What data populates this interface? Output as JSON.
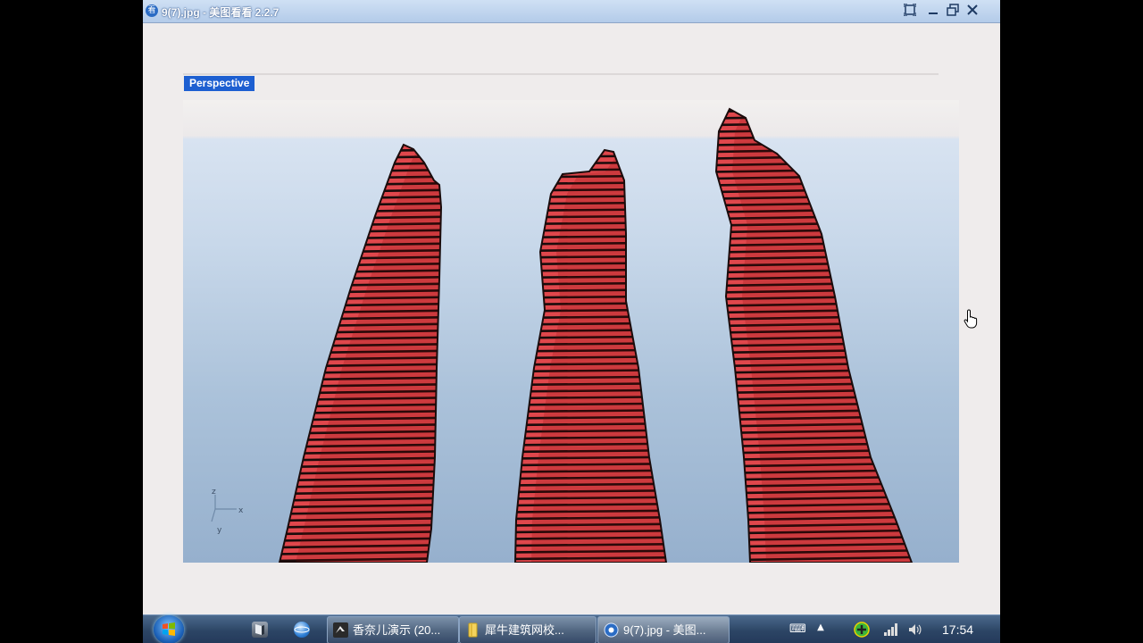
{
  "window": {
    "title": "9(7).jpg - 美图看看 2.2.7",
    "app_icon_glyph": "看",
    "controls": [
      "fullscreen",
      "minimize",
      "restore",
      "close"
    ]
  },
  "viewer": {
    "viewport_label": "Perspective",
    "axis_labels": {
      "z": "z",
      "x": "x",
      "y": "y"
    },
    "model_color": "#e0474c",
    "stripe_color": "#1a0b0b"
  },
  "taskbar": {
    "quick_launch": [
      "desktop-icon",
      "browser-icon"
    ],
    "tasks": [
      {
        "label": "香奈儿演示 (20...",
        "icon": "video-app-icon",
        "active": false
      },
      {
        "label": "犀牛建筑网校...",
        "icon": "folder-icon",
        "active": false
      },
      {
        "label": "9(7).jpg - 美图...",
        "icon": "meitu-viewer-icon",
        "active": true
      }
    ],
    "tray_icons": [
      "keyboard-icon",
      "show-hidden-icon",
      "security-icon",
      "network-icon",
      "volume-icon"
    ],
    "clock": "17:54"
  },
  "colors": {
    "accent": "#1d5fd1",
    "taskbar": "#2c4565"
  }
}
